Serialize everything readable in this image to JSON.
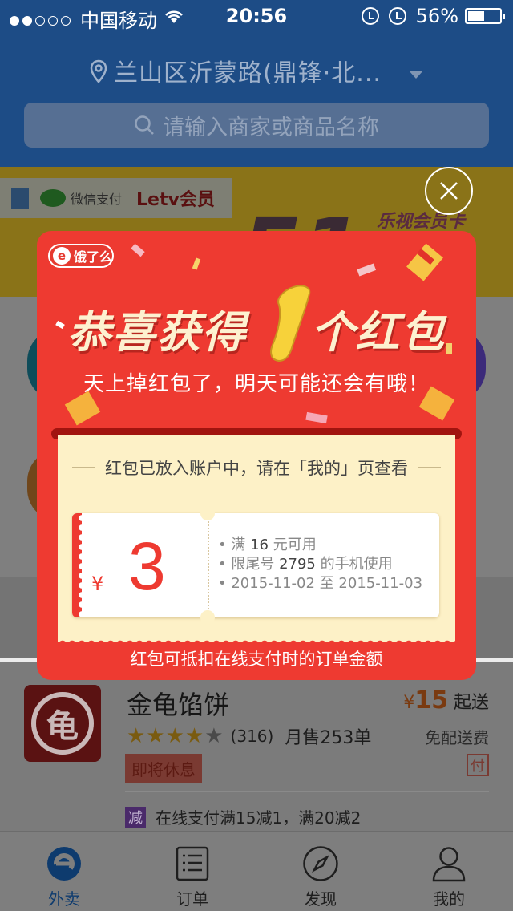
{
  "status": {
    "carrier": "中国移动",
    "time": "20:56",
    "battery": "56%",
    "battery_level": 0.56,
    "signal_bars": 2
  },
  "header": {
    "location": "兰山区沂蒙路(鼎锋·北...",
    "search_placeholder": "请输入商家或商品名称"
  },
  "banner": {
    "wechat_pay": "微信支付",
    "letv": "Letv会员",
    "slogan": "乐视会员卡",
    "big_text": "51"
  },
  "shop": {
    "name": "金龟馅饼",
    "rating_count": "(316)",
    "monthly_sales": "月售253单",
    "rating_stars": 4.5,
    "closing_soon": "即将休息",
    "min_price_symbol": "¥",
    "min_price": "15",
    "min_price_suffix": "起送",
    "delivery": "免配送费",
    "pay_badge": "付",
    "promo_icon": "减",
    "promo": "在线支付满15减1，满20减2"
  },
  "tabs": [
    {
      "label": "外卖",
      "icon": "takeout-icon",
      "active": true
    },
    {
      "label": "订单",
      "icon": "orders-icon",
      "active": false
    },
    {
      "label": "发现",
      "icon": "compass-icon",
      "active": false
    },
    {
      "label": "我的",
      "icon": "profile-icon",
      "active": false
    }
  ],
  "modal": {
    "brand": "饿了么",
    "headline_left": "恭喜获得",
    "headline_right": "个红包",
    "headline_digit": "1",
    "subtitle": "天上掉红包了，明天可能还会有哦！",
    "notice": "红包已放入账户中，请在「我的」页查看",
    "coupon": {
      "currency": "¥",
      "amount": "3",
      "min_spend_prefix": "满",
      "min_spend_value": "16",
      "min_spend_suffix": "元可用",
      "phone_prefix": "限尾号",
      "phone_tail": "2795",
      "phone_suffix": "的手机使用",
      "date_from": "2015-11-02",
      "date_sep": "至",
      "date_to": "2015-11-03"
    },
    "footnote": "红包可抵扣在线支付时的订单金额"
  },
  "colors": {
    "header_blue": "#1d4c86",
    "modal_red": "#ee3a31",
    "paper": "#fdf1c7",
    "headline": "#fdf1d0"
  }
}
